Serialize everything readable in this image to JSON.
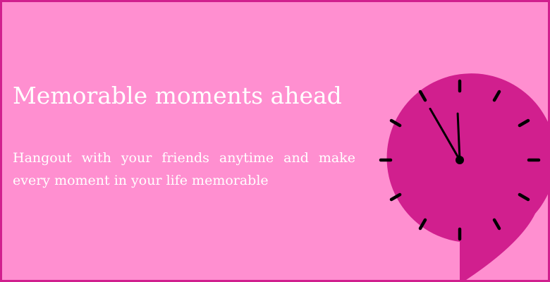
{
  "banner": {
    "headline": "Memorable moments ahead",
    "subtitle": "Hangout with your friends anytime and make every moment in your life memorable"
  },
  "clock": {
    "hour": 11,
    "minute": 55,
    "face_color": "#d11f8e",
    "mark_color": "#000000"
  },
  "colors": {
    "background": "#ff8fd0",
    "border": "#d11f8e",
    "text": "#ffffff"
  }
}
